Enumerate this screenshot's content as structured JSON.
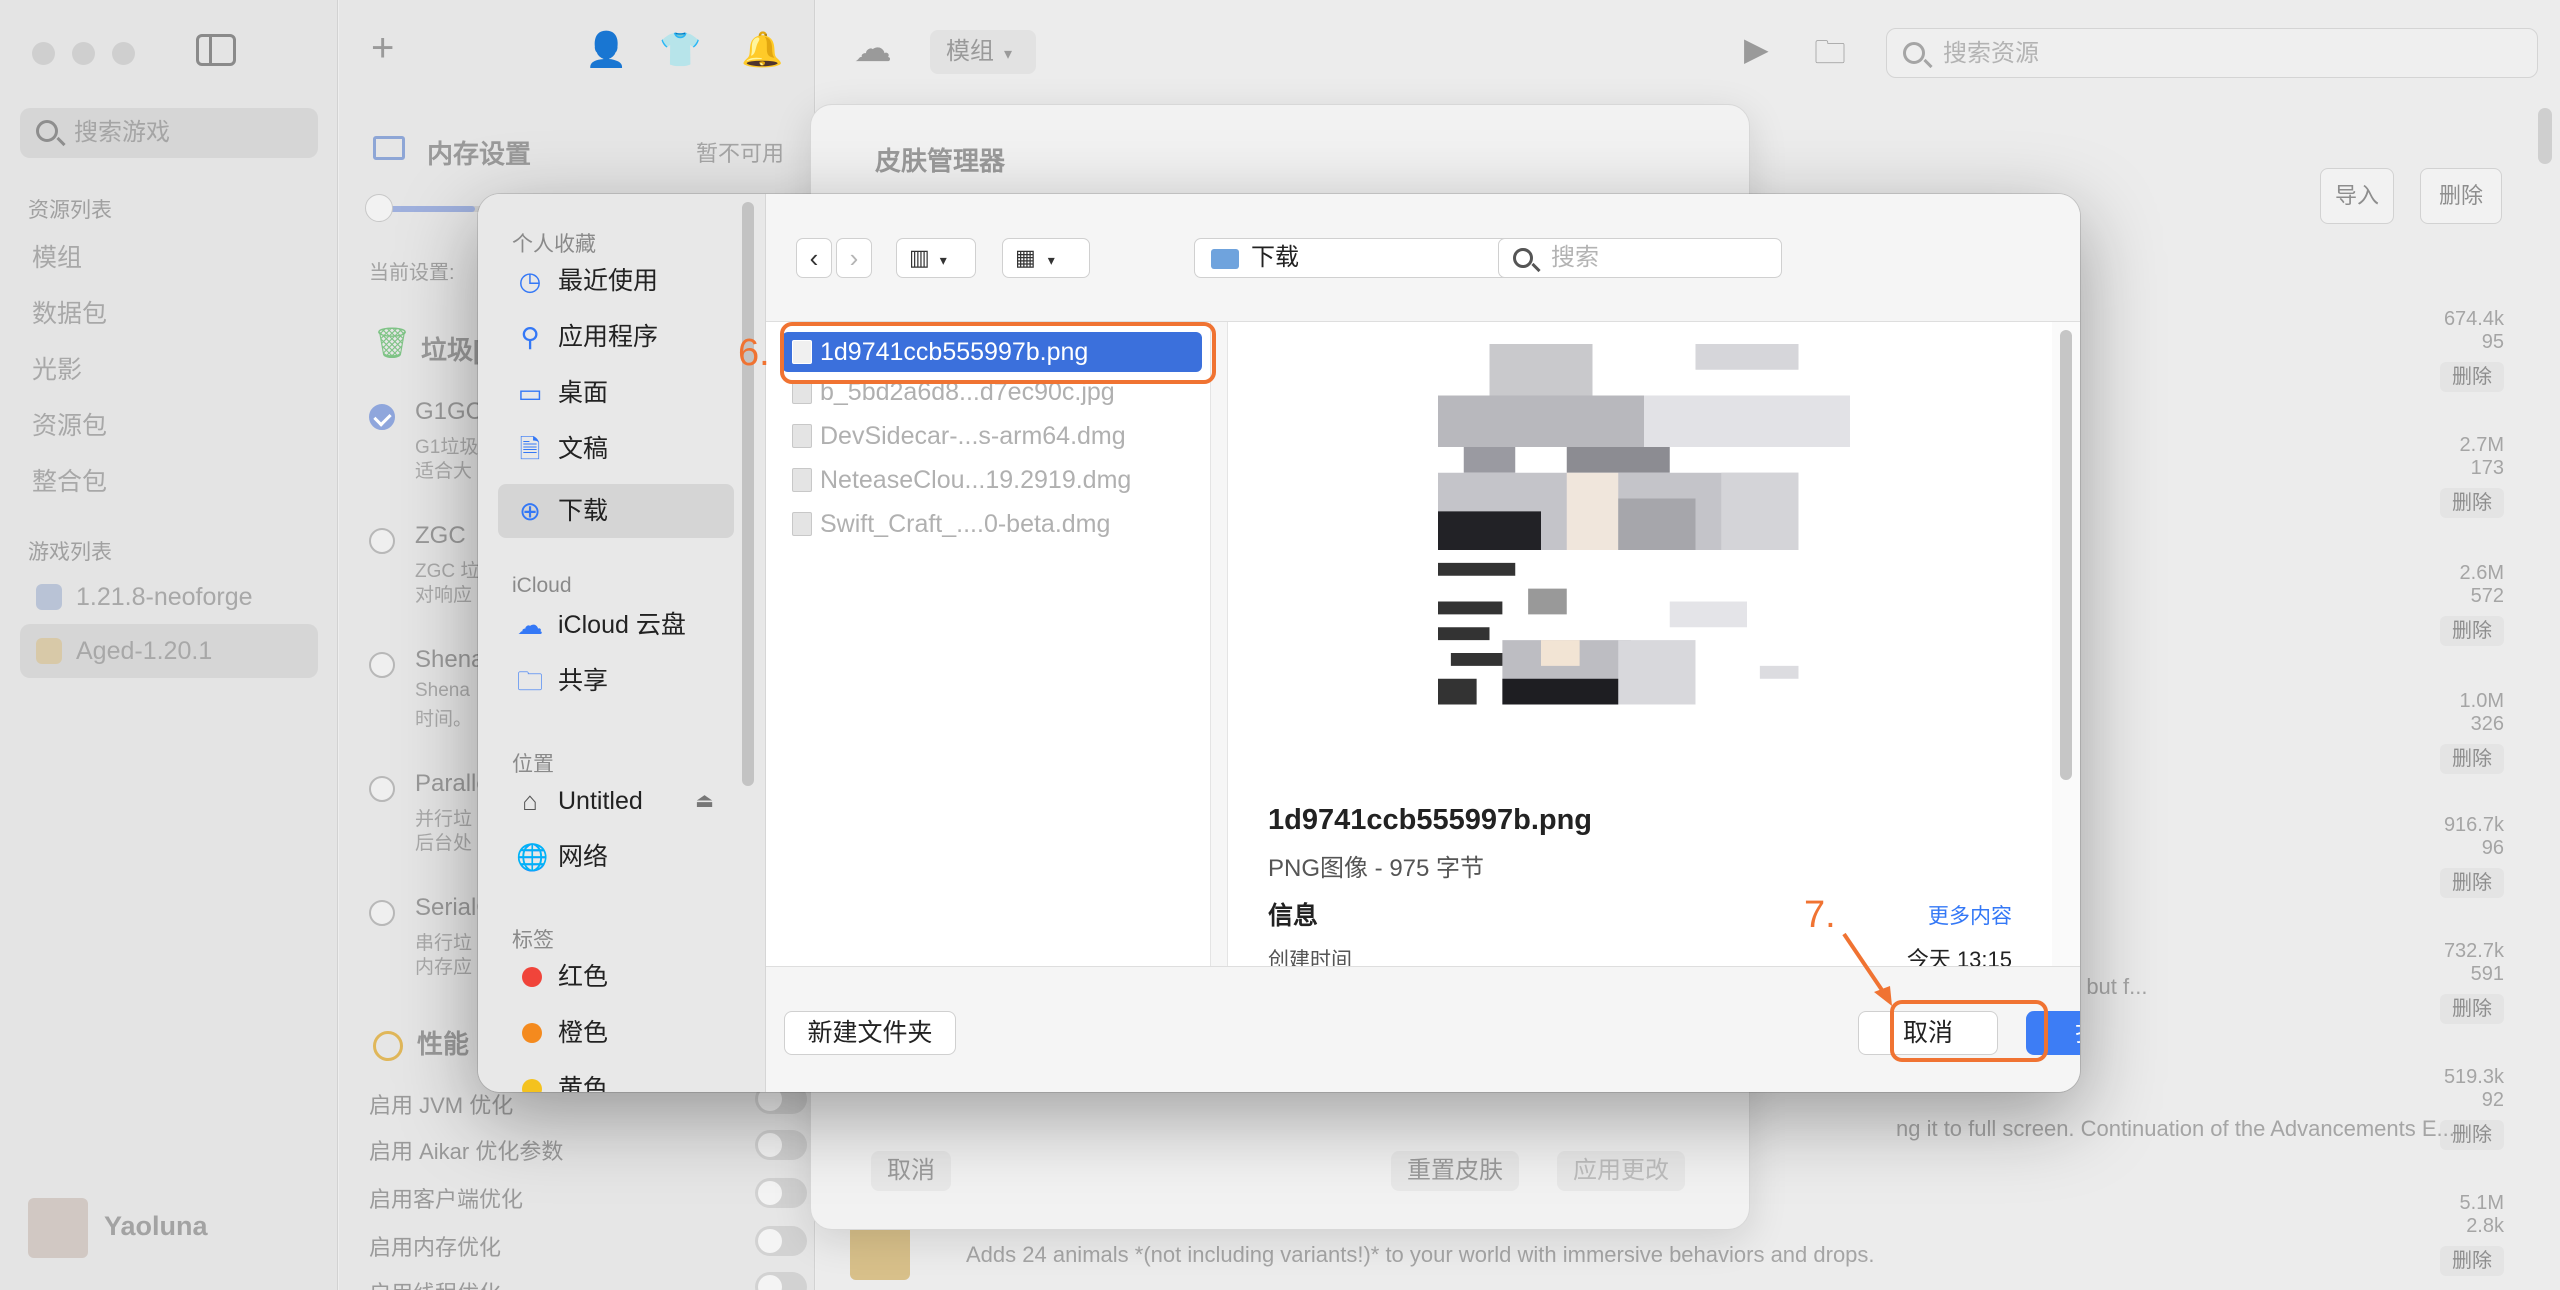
{
  "sidebar": {
    "search_placeholder": "搜索游戏",
    "resource_header": "资源列表",
    "resources": [
      "模组",
      "数据包",
      "光影",
      "资源包",
      "整合包"
    ],
    "game_header": "游戏列表",
    "games": [
      "1.21.8-neoforge",
      "Aged-1.20.1"
    ],
    "user_name": "Yaoluna"
  },
  "settings": {
    "memory_title": "内存设置",
    "unavailable": "暂不可用",
    "current_label": "当前设置:",
    "gc_title_partial": "垃圾[",
    "gc_options": [
      {
        "name": "G1GC",
        "desc1": "G1垃圾",
        "desc2": "适合大"
      },
      {
        "name": "ZGC ",
        "desc1": "ZGC 垃",
        "desc2": "对响应"
      },
      {
        "name": "Shena",
        "desc1": "Shena",
        "desc2": "时间。"
      },
      {
        "name": "Paralle",
        "desc1": "并行垃",
        "desc2": "后台处"
      },
      {
        "name": "SerialG",
        "desc1": "串行垃",
        "desc2": "内存应"
      }
    ],
    "perf_title": "性能",
    "switches": [
      "启用 JVM 优化",
      "启用 Aikar 优化参数",
      "启用客户端优化",
      "启用内存优化",
      "启用线程优化"
    ]
  },
  "toolbar": {
    "segment_label": "模组",
    "search_placeholder": "搜索资源",
    "import_label": "导入",
    "delete_label": "删除"
  },
  "mods": [
    {
      "downloads": "674.4k",
      "likes": "95",
      "action": "删除"
    },
    {
      "downloads": "2.7M",
      "likes": "173",
      "action": "删除"
    },
    {
      "downloads": "2.6M",
      "likes": "572",
      "action": "删除"
    },
    {
      "downloads": "1.0M",
      "likes": "326",
      "action": "删除"
    },
    {
      "downloads": "916.7k",
      "likes": "96",
      "action": "删除"
    },
    {
      "downloads": "732.7k",
      "likes": "591",
      "action": "删除"
    },
    {
      "downloads": "519.3k",
      "likes": "92",
      "action": "删除"
    },
    {
      "downloads": "5.1M",
      "likes": "2.8k",
      "action": "删除"
    }
  ],
  "mod_descriptions": [
    "s, along with tricky, but f...",
    "ng it to full screen. Continuation of the Advancements E...",
    "Adds 24 animals *(not including variants!)* to your world with immersive behaviors and drops."
  ],
  "skin_manager": {
    "title": "皮肤管理器",
    "cancel": "取消",
    "reset": "重置皮肤",
    "apply": "应用更改"
  },
  "dialog": {
    "favorites_header": "个人收藏",
    "favorites": [
      "最近使用",
      "应用程序",
      "桌面",
      "文稿",
      "下载"
    ],
    "icloud_header": "iCloud",
    "icloud": [
      "iCloud 云盘",
      "共享"
    ],
    "locations_header": "位置",
    "locations": [
      "Untitled",
      "网络"
    ],
    "tags_header": "标签",
    "tags": [
      {
        "name": "红色",
        "color": "#f0443a"
      },
      {
        "name": "橙色",
        "color": "#f48a1e"
      },
      {
        "name": "黄色",
        "color": "#f4c21e"
      }
    ],
    "current_folder": "下载",
    "search_placeholder": "搜索",
    "files": [
      "1d9741ccb555997b.png",
      "b_5bd2a6d8...d7ec90c.jpg",
      "DevSidecar-...s-arm64.dmg",
      "NeteaseClou...19.2919.dmg",
      "Swift_Craft_....0-beta.dmg"
    ],
    "preview": {
      "name": "1d9741ccb555997b.png",
      "kind": "PNG图像 - 975 字节",
      "info_label": "信息",
      "more_label": "更多内容",
      "created_label": "创建时间",
      "created_value": "今天 13:15"
    },
    "new_folder": "新建文件夹",
    "cancel": "取消",
    "open": "打开"
  },
  "annotations": {
    "step6": "6.",
    "step7": "7.",
    "color": "#f07332"
  }
}
